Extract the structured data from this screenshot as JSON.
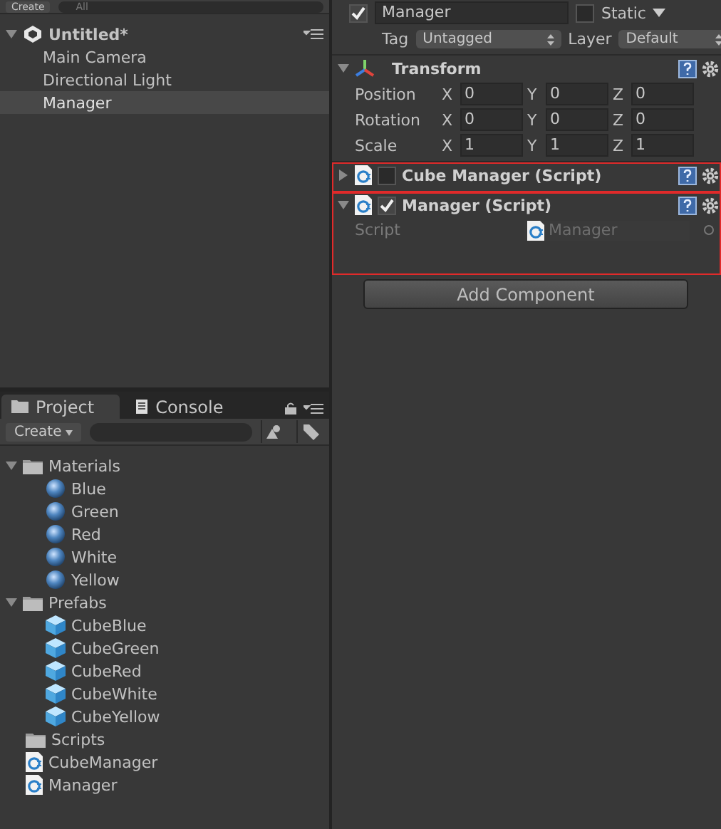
{
  "hierarchy": {
    "toolbar": {
      "create": "Create",
      "search_placeholder": "All"
    },
    "scene": {
      "name": "Untitled*",
      "expanded": true,
      "children": [
        {
          "label": "Main Camera",
          "selected": false
        },
        {
          "label": "Directional Light",
          "selected": false
        },
        {
          "label": "Manager",
          "selected": true
        }
      ]
    }
  },
  "project": {
    "tabs": [
      {
        "label": "Project",
        "selected": true,
        "kind": "folder"
      },
      {
        "label": "Console",
        "selected": false,
        "kind": "console"
      }
    ],
    "toolbar": {
      "create": "Create"
    },
    "tree": [
      {
        "label": "Materials",
        "kind": "folder",
        "expanded": true,
        "children": [
          {
            "label": "Blue",
            "kind": "material"
          },
          {
            "label": "Green",
            "kind": "material"
          },
          {
            "label": "Red",
            "kind": "material"
          },
          {
            "label": "White",
            "kind": "material"
          },
          {
            "label": "Yellow",
            "kind": "material"
          }
        ]
      },
      {
        "label": "Prefabs",
        "kind": "folder",
        "expanded": true,
        "children": [
          {
            "label": "CubeBlue",
            "kind": "prefab"
          },
          {
            "label": "CubeGreen",
            "kind": "prefab"
          },
          {
            "label": "CubeRed",
            "kind": "prefab"
          },
          {
            "label": "CubeWhite",
            "kind": "prefab"
          },
          {
            "label": "CubeYellow",
            "kind": "prefab"
          }
        ]
      },
      {
        "label": "Scripts",
        "kind": "folder"
      },
      {
        "label": "CubeManager",
        "kind": "script"
      },
      {
        "label": "Manager",
        "kind": "script"
      }
    ]
  },
  "inspector": {
    "object": {
      "active": true,
      "name": "Manager",
      "static": false,
      "static_label": "Static",
      "tag_label": "Tag",
      "tag": "Untagged",
      "layer_label": "Layer",
      "layer": "Default"
    },
    "components": [
      {
        "kind": "transform",
        "title": "Transform",
        "expanded": true,
        "highlighted": false,
        "rows": [
          {
            "label": "Position",
            "values": [
              {
                "axis": "X",
                "value": "0"
              },
              {
                "axis": "Y",
                "value": "0"
              },
              {
                "axis": "Z",
                "value": "0"
              }
            ]
          },
          {
            "label": "Rotation",
            "values": [
              {
                "axis": "X",
                "value": "0"
              },
              {
                "axis": "Y",
                "value": "0"
              },
              {
                "axis": "Z",
                "value": "0"
              }
            ]
          },
          {
            "label": "Scale",
            "values": [
              {
                "axis": "X",
                "value": "1"
              },
              {
                "axis": "Y",
                "value": "1"
              },
              {
                "axis": "Z",
                "value": "1"
              }
            ]
          }
        ]
      },
      {
        "kind": "script",
        "title": "Cube Manager (Script)",
        "expanded": false,
        "enabled": false,
        "highlighted": true
      },
      {
        "kind": "script",
        "title": "Manager (Script)",
        "expanded": true,
        "enabled": true,
        "highlighted": true,
        "fields": [
          {
            "label": "Script",
            "value": "Manager"
          }
        ]
      }
    ],
    "add_component": "Add Component"
  }
}
